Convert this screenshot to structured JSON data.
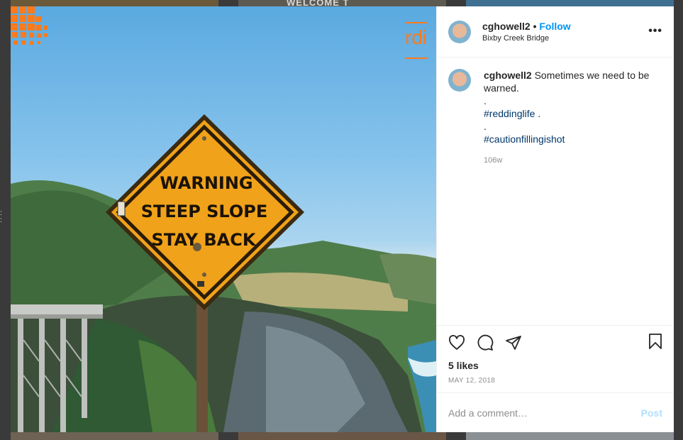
{
  "background": {
    "welcome_text": "WELCOME T"
  },
  "photo": {
    "sign_lines": [
      "WARNING",
      "STEEP SLOPE",
      "STAY BACK"
    ],
    "watermark": "rdi"
  },
  "header": {
    "username": "cghowell2",
    "separator": " • ",
    "follow_label": "Follow",
    "location": "Bixby Creek Bridge",
    "more_icon": "more-icon"
  },
  "caption": {
    "username": "cghowell2",
    "text": "Sometimes we need to be warned.",
    "dot1": ".",
    "hashtag1": "#reddinglife",
    "hashtag1_suffix": " .",
    "dot2": ".",
    "hashtag2": "#cautionfillingishot",
    "time_ago": "106w"
  },
  "actions": {
    "like_icon": "heart-icon",
    "comment_icon": "comment-icon",
    "share_icon": "share-icon",
    "save_icon": "bookmark-icon",
    "likes": "5 likes",
    "date": "MAY 12, 2018"
  },
  "comment": {
    "placeholder": "Add a comment…",
    "post_label": "Post"
  },
  "colors": {
    "link": "#0095f6",
    "hashtag": "#00376b",
    "sign": "#f0a21a",
    "watermark": "#ff7a1a"
  }
}
